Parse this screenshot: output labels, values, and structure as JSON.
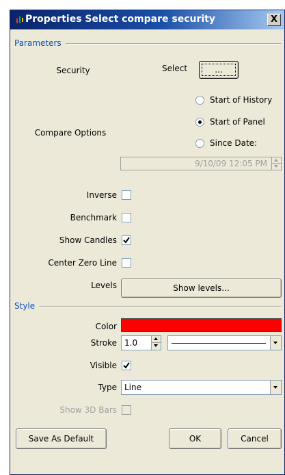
{
  "window": {
    "title": "Properties Select compare security",
    "close_glyph": "X",
    "icon": "app-chart-icon"
  },
  "parameters": {
    "group_label": "Parameters",
    "security": {
      "label": "Security",
      "select_label": "Select",
      "button_label": "..."
    },
    "compare_options": {
      "label": "Compare Options",
      "options": [
        "Start of History",
        "Start of Panel",
        "Since Date:"
      ],
      "selected": "Start of Panel",
      "since_date_value": "9/10/09 12:05 PM"
    },
    "inverse": {
      "label": "Inverse",
      "checked": false
    },
    "benchmark": {
      "label": "Benchmark",
      "checked": false
    },
    "show_candles": {
      "label": "Show Candles",
      "checked": true
    },
    "center_zero_line": {
      "label": "Center Zero Line",
      "checked": false
    },
    "levels": {
      "label": "Levels",
      "button_label": "Show levels..."
    }
  },
  "style": {
    "group_label": "Style",
    "color": {
      "label": "Color",
      "value": "#ff0000"
    },
    "stroke": {
      "label": "Stroke",
      "width_value": "1.0",
      "line_style": "solid"
    },
    "visible": {
      "label": "Visible",
      "checked": true
    },
    "type": {
      "label": "Type",
      "value": "Line"
    },
    "show_3d_bars": {
      "label": "Show 3D Bars",
      "checked": false,
      "disabled": true
    }
  },
  "footer": {
    "save_default_label": "Save As Default",
    "ok_label": "OK",
    "cancel_label": "Cancel"
  },
  "colors": {
    "group_header_text": "#0b52c3",
    "dialog_bg": "#ece9d8",
    "title_gradient_start": "#0a246a"
  }
}
